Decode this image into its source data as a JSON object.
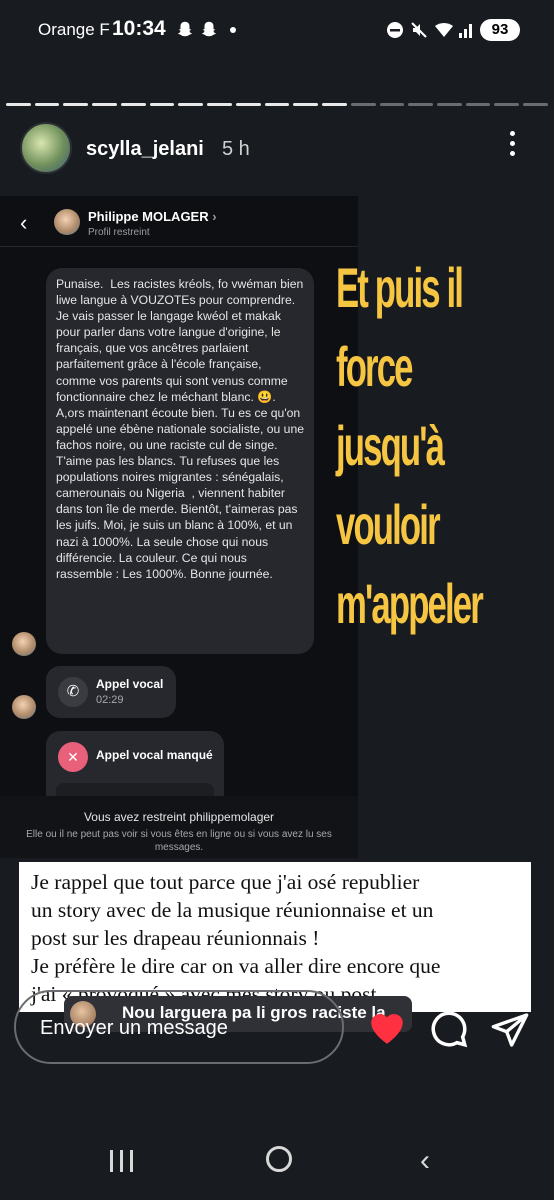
{
  "status_bar": {
    "carrier": "Orange F",
    "time": "10:34",
    "battery": "93",
    "icons": [
      "snapchat-icon",
      "snapchat-icon",
      "dnd-icon",
      "mute-icon",
      "wifi-icon",
      "signal-icon"
    ]
  },
  "story": {
    "username": "scylla_jelani",
    "posted": "5 h",
    "progress_segments_total": 19,
    "progress_segments_viewed": 12
  },
  "chat_screenshot": {
    "contact_name": "Philippe MOLAGER",
    "contact_sub": "Profil restreint",
    "message": "Punaise.  Les racistes kréols, fo vwéman bien liwe langue à VOUZOTEs pour comprendre. Je vais passer le langage kwéol et makak pour parler dans votre langue d'origine, le français, que vos ancêtres parlaient parfaitement grâce à l'école française,  comme vos parents qui sont venus comme fonctionnaire chez le méchant blanc. 😃. A,ors maintenant écoute bien. Tu es ce qu'on appelé une ébène nationale socialiste, ou une fachos noire, ou une raciste cul de singe. T'aime pas les blancs. Tu refuses que les populations noires migrantes : sénégalais, camerounais ou Nigeria  , viennent habiter dans ton île de merde. Bientôt, t'aimeras pas les juifs. Moi, je suis un blanc à 100%, et un nazi à 1000%. La seule chose qui nous différencie. La couleur. Ce qui nous rassemble : Les 1000%. Bonne journée.",
    "call1_title": "Appel vocal",
    "call1_duration": "02:29",
    "call2_title": "Appel vocal manqué",
    "restrict_title": "Vous avez restreint philippemolager",
    "restrict_desc": "Elle ou il ne peut pas voir si vous êtes en ligne ou si vous avez lu ses messages."
  },
  "overlay_text": [
    "Et puis il",
    "force",
    "jusqu'à",
    "vouloir",
    "m'appeler"
  ],
  "overlay_color": "#f6c542",
  "caption_lines": [
    "Je rappel que tout parce que j'ai osé republier",
    "un story avec de la musique réunionnaise et un",
    "post sur les drapeau réunionnais !",
    "Je préfère le dire car on va aller dire encore que",
    "j'ai « provoqué » avec mes story ou post"
  ],
  "music_sticker": "Nou larguera pa li gros raciste la",
  "reply": {
    "placeholder": "Envoyer un message"
  }
}
